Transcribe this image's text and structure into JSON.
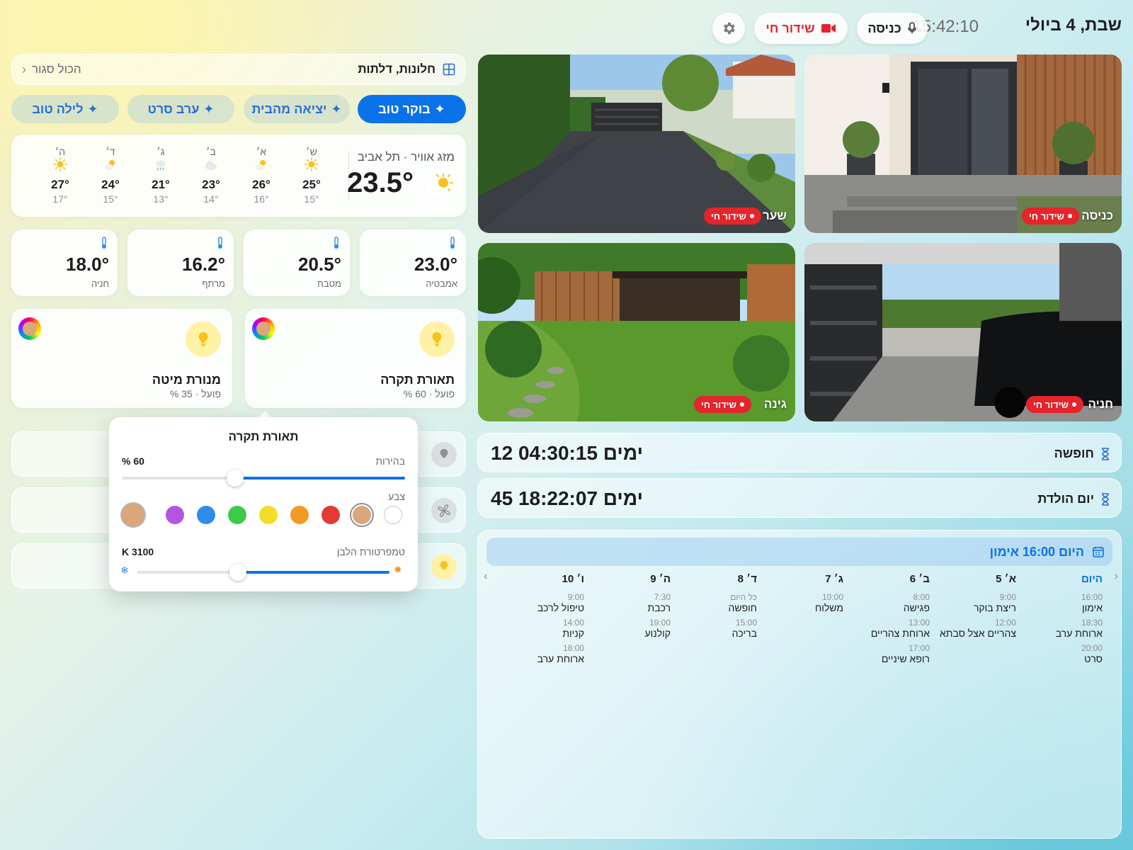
{
  "header": {
    "date": "שבת, 4 ביולי",
    "dash": "—",
    "time": "15:42:10",
    "entry_button": "כניסה",
    "live_button": "שידור חי"
  },
  "openings": {
    "title": "חלונות, דלתות",
    "status": "הכול סגור"
  },
  "scenes": [
    "בוקר טוב",
    "יציאה מהבית",
    "ערב סרט",
    "לילה טוב"
  ],
  "weather": {
    "title": "מזג אוויר · תל אביב",
    "current": "23.5°",
    "forecast": [
      {
        "day": "ש׳",
        "icon": "sun-icon",
        "hi": "25°",
        "lo": "15°"
      },
      {
        "day": "א׳",
        "icon": "partly-sunny-icon",
        "hi": "26°",
        "lo": "16°"
      },
      {
        "day": "ב׳",
        "icon": "cloud-icon",
        "hi": "23°",
        "lo": "14°"
      },
      {
        "day": "ג׳",
        "icon": "rain-icon",
        "hi": "21°",
        "lo": "13°"
      },
      {
        "day": "ד׳",
        "icon": "partly-sunny-icon",
        "hi": "24°",
        "lo": "15°"
      },
      {
        "day": "ה׳",
        "icon": "sun-icon",
        "hi": "27°",
        "lo": "17°"
      }
    ]
  },
  "temperatures": [
    {
      "value": "23.0°",
      "room": "אמבטיה"
    },
    {
      "value": "20.5°",
      "room": "מטבח"
    },
    {
      "value": "16.2°",
      "room": "מרתף"
    },
    {
      "value": "18.0°",
      "room": "חניה"
    }
  ],
  "lights": [
    {
      "name": "תאורת תקרה",
      "status": "פועל · 60 %"
    },
    {
      "name": "מנורת מיטה",
      "status": "פועל · 35 %"
    }
  ],
  "popover": {
    "title": "תאורת תקרה",
    "brightness_label": "בהירות",
    "brightness_value": "60 %",
    "brightness": 0.6,
    "color_label": "צבע",
    "colors": [
      "#ffffff",
      "#d9a77a",
      "#e53935",
      "#f39a24",
      "#f4dc2a",
      "#3ec94a",
      "#2f8ce8",
      "#b455e0"
    ],
    "selected_color": "#d9a77a",
    "temp_label": "טמפרטורת הלבן",
    "temp_value": "3100 K",
    "temp_level": 0.6
  },
  "cameras": [
    {
      "name": "כניסה",
      "live": "שידור חי"
    },
    {
      "name": "שער",
      "live": "שידור חי"
    },
    {
      "name": "חניה",
      "live": "שידור חי"
    },
    {
      "name": "גינה",
      "live": "שידור חי"
    }
  ],
  "countdowns": [
    {
      "name": "חופשה",
      "value": "12 ימים 04:30:15"
    },
    {
      "name": "יום הולדת",
      "value": "45 ימים 18:22:07"
    }
  ],
  "calendar": {
    "header": "היום 16:00 אימון",
    "days": [
      {
        "label": "היום",
        "events": [
          {
            "time": "16:00",
            "title": "אימון"
          },
          {
            "time": "18:30",
            "title": "ארוחת ערב"
          },
          {
            "time": "20:00",
            "title": "סרט"
          }
        ]
      },
      {
        "label": "א׳ 5",
        "events": [
          {
            "time": "9:00",
            "title": "ריצת בוקר"
          },
          {
            "time": "12:00",
            "title": "צהריים אצל סבתא"
          }
        ]
      },
      {
        "label": "ב׳ 6",
        "events": [
          {
            "time": "8:00",
            "title": "פגישה"
          },
          {
            "time": "13:00",
            "title": "ארוחת צהריים"
          },
          {
            "time": "17:00",
            "title": "רופא שיניים"
          }
        ]
      },
      {
        "label": "ג׳ 7",
        "events": [
          {
            "time": "10:00",
            "title": "משלוח"
          }
        ]
      },
      {
        "label": "ד׳ 8",
        "events": [
          {
            "time": "כל היום",
            "title": "חופשה"
          },
          {
            "time": "15:00",
            "title": "בריכה"
          }
        ]
      },
      {
        "label": "ה׳ 9",
        "events": [
          {
            "time": "7:30",
            "title": "רכבת"
          },
          {
            "time": "19:00",
            "title": "קולנוע"
          }
        ]
      },
      {
        "label": "ו׳ 10",
        "events": [
          {
            "time": "9:00",
            "title": "טיפול לרכב"
          },
          {
            "time": "14:00",
            "title": "קניות"
          },
          {
            "time": "18:00",
            "title": "ארוחת ערב"
          }
        ]
      }
    ]
  }
}
